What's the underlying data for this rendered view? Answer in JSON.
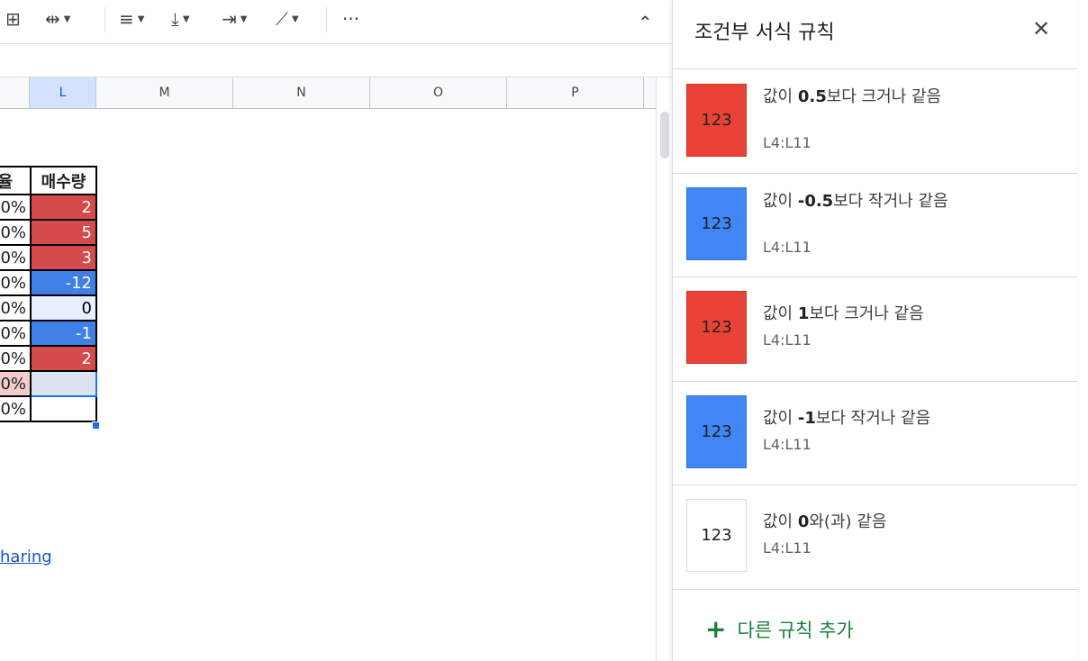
{
  "toolbar": {
    "icons": [
      "grid-icon",
      "merge-icon",
      "align-icon",
      "valign-icon",
      "wrap-icon",
      "rotate-icon",
      "more-icon",
      "collapse-icon"
    ],
    "glyphs": {
      "grid": "⊞",
      "merge": "⇹",
      "align": "≡",
      "valign": "⤓",
      "wrap": "⇥",
      "rotate": "⟋",
      "more": "···",
      "collapse": "⌃",
      "dropdown": "▼"
    }
  },
  "columns": [
    "L",
    "M",
    "N",
    "O",
    "P"
  ],
  "table": {
    "header": [
      "비율",
      "매수량"
    ],
    "rows": [
      {
        "k": "0%",
        "l": "2",
        "style": "red"
      },
      {
        "k": "0%",
        "l": "5",
        "style": "red"
      },
      {
        "k": "0%",
        "l": "3",
        "style": "red"
      },
      {
        "k": "0%",
        "l": "-12",
        "style": "blue"
      },
      {
        "k": "0%",
        "l": "0",
        "style": "lightblue"
      },
      {
        "k": "0%",
        "l": "-1",
        "style": "blue"
      },
      {
        "k": "0%",
        "l": "2",
        "style": "red"
      },
      {
        "k": "0%",
        "l": "",
        "style": "selected"
      },
      {
        "k": "0%",
        "l": "",
        "style": "plain"
      }
    ]
  },
  "link_text": "haring",
  "panel": {
    "title": "조건부 서식 규칙",
    "close_glyph": "✕",
    "rules": [
      {
        "prefix": "값이 ",
        "value": "0.5",
        "suffix": "보다 크거나 같음",
        "range": "L4:L11",
        "sample": "123",
        "color": "#ea4335"
      },
      {
        "prefix": "값이 ",
        "value": "-0.5",
        "suffix": "보다 작거나 같음",
        "range": "L4:L11",
        "sample": "123",
        "color": "#4285f4"
      },
      {
        "prefix": "값이 ",
        "value": "1",
        "suffix": "보다 크거나 같음",
        "range": "L4:L11",
        "sample": "123",
        "color": "#ea4335"
      },
      {
        "prefix": "값이 ",
        "value": "-1",
        "suffix": "보다 작거나 같음",
        "range": "L4:L11",
        "sample": "123",
        "color": "#4285f4"
      },
      {
        "prefix": "값이 ",
        "value": "0",
        "suffix": "와(과) 같음",
        "range": "L4:L11",
        "sample": "123",
        "color": "#ffffff"
      }
    ],
    "add_rule_label": "다른 규칙 추가",
    "add_glyph": "+"
  }
}
